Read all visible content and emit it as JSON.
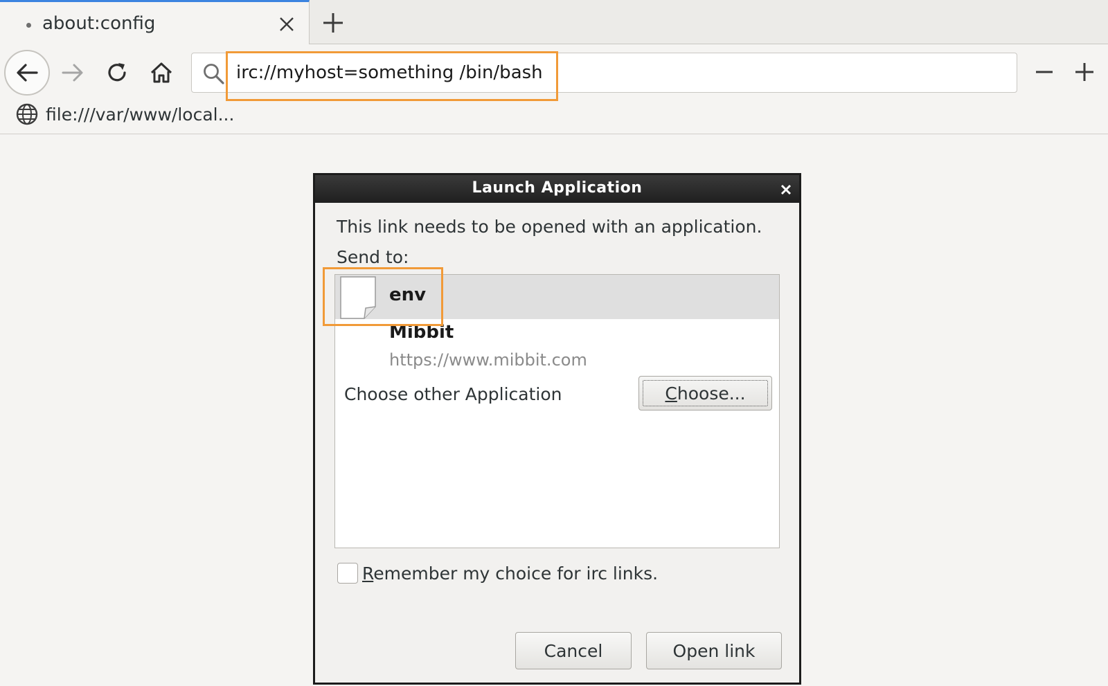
{
  "tab": {
    "title": "about:config"
  },
  "navbar": {
    "url": "irc://myhost=something /bin/bash",
    "site_info": "file:///var/www/local..."
  },
  "dialog": {
    "title": "Launch Application",
    "message": "This link needs to be opened with an application.",
    "send_to_label": "Send to:",
    "apps": [
      {
        "name": "env",
        "selected": true
      },
      {
        "name": "Mibbit",
        "url": "https://www.mibbit.com",
        "selected": false
      }
    ],
    "choose_other_label": "Choose other Application",
    "choose_button": {
      "mnemonic": "C",
      "rest": "hoose..."
    },
    "remember": {
      "mnemonic": "R",
      "rest": "emember my choice for irc links.",
      "checked": false
    },
    "cancel_label": "Cancel",
    "open_label": "Open link"
  },
  "colors": {
    "tab_accent": "#3b84e0",
    "highlight": "#f19a38",
    "dialog_titlebar": "#1f1f1f"
  },
  "icons": [
    "close-icon",
    "plus-icon",
    "back-arrow-icon",
    "forward-arrow-icon",
    "reload-icon",
    "home-icon",
    "search-icon",
    "minus-icon",
    "globe-icon",
    "document-icon"
  ]
}
